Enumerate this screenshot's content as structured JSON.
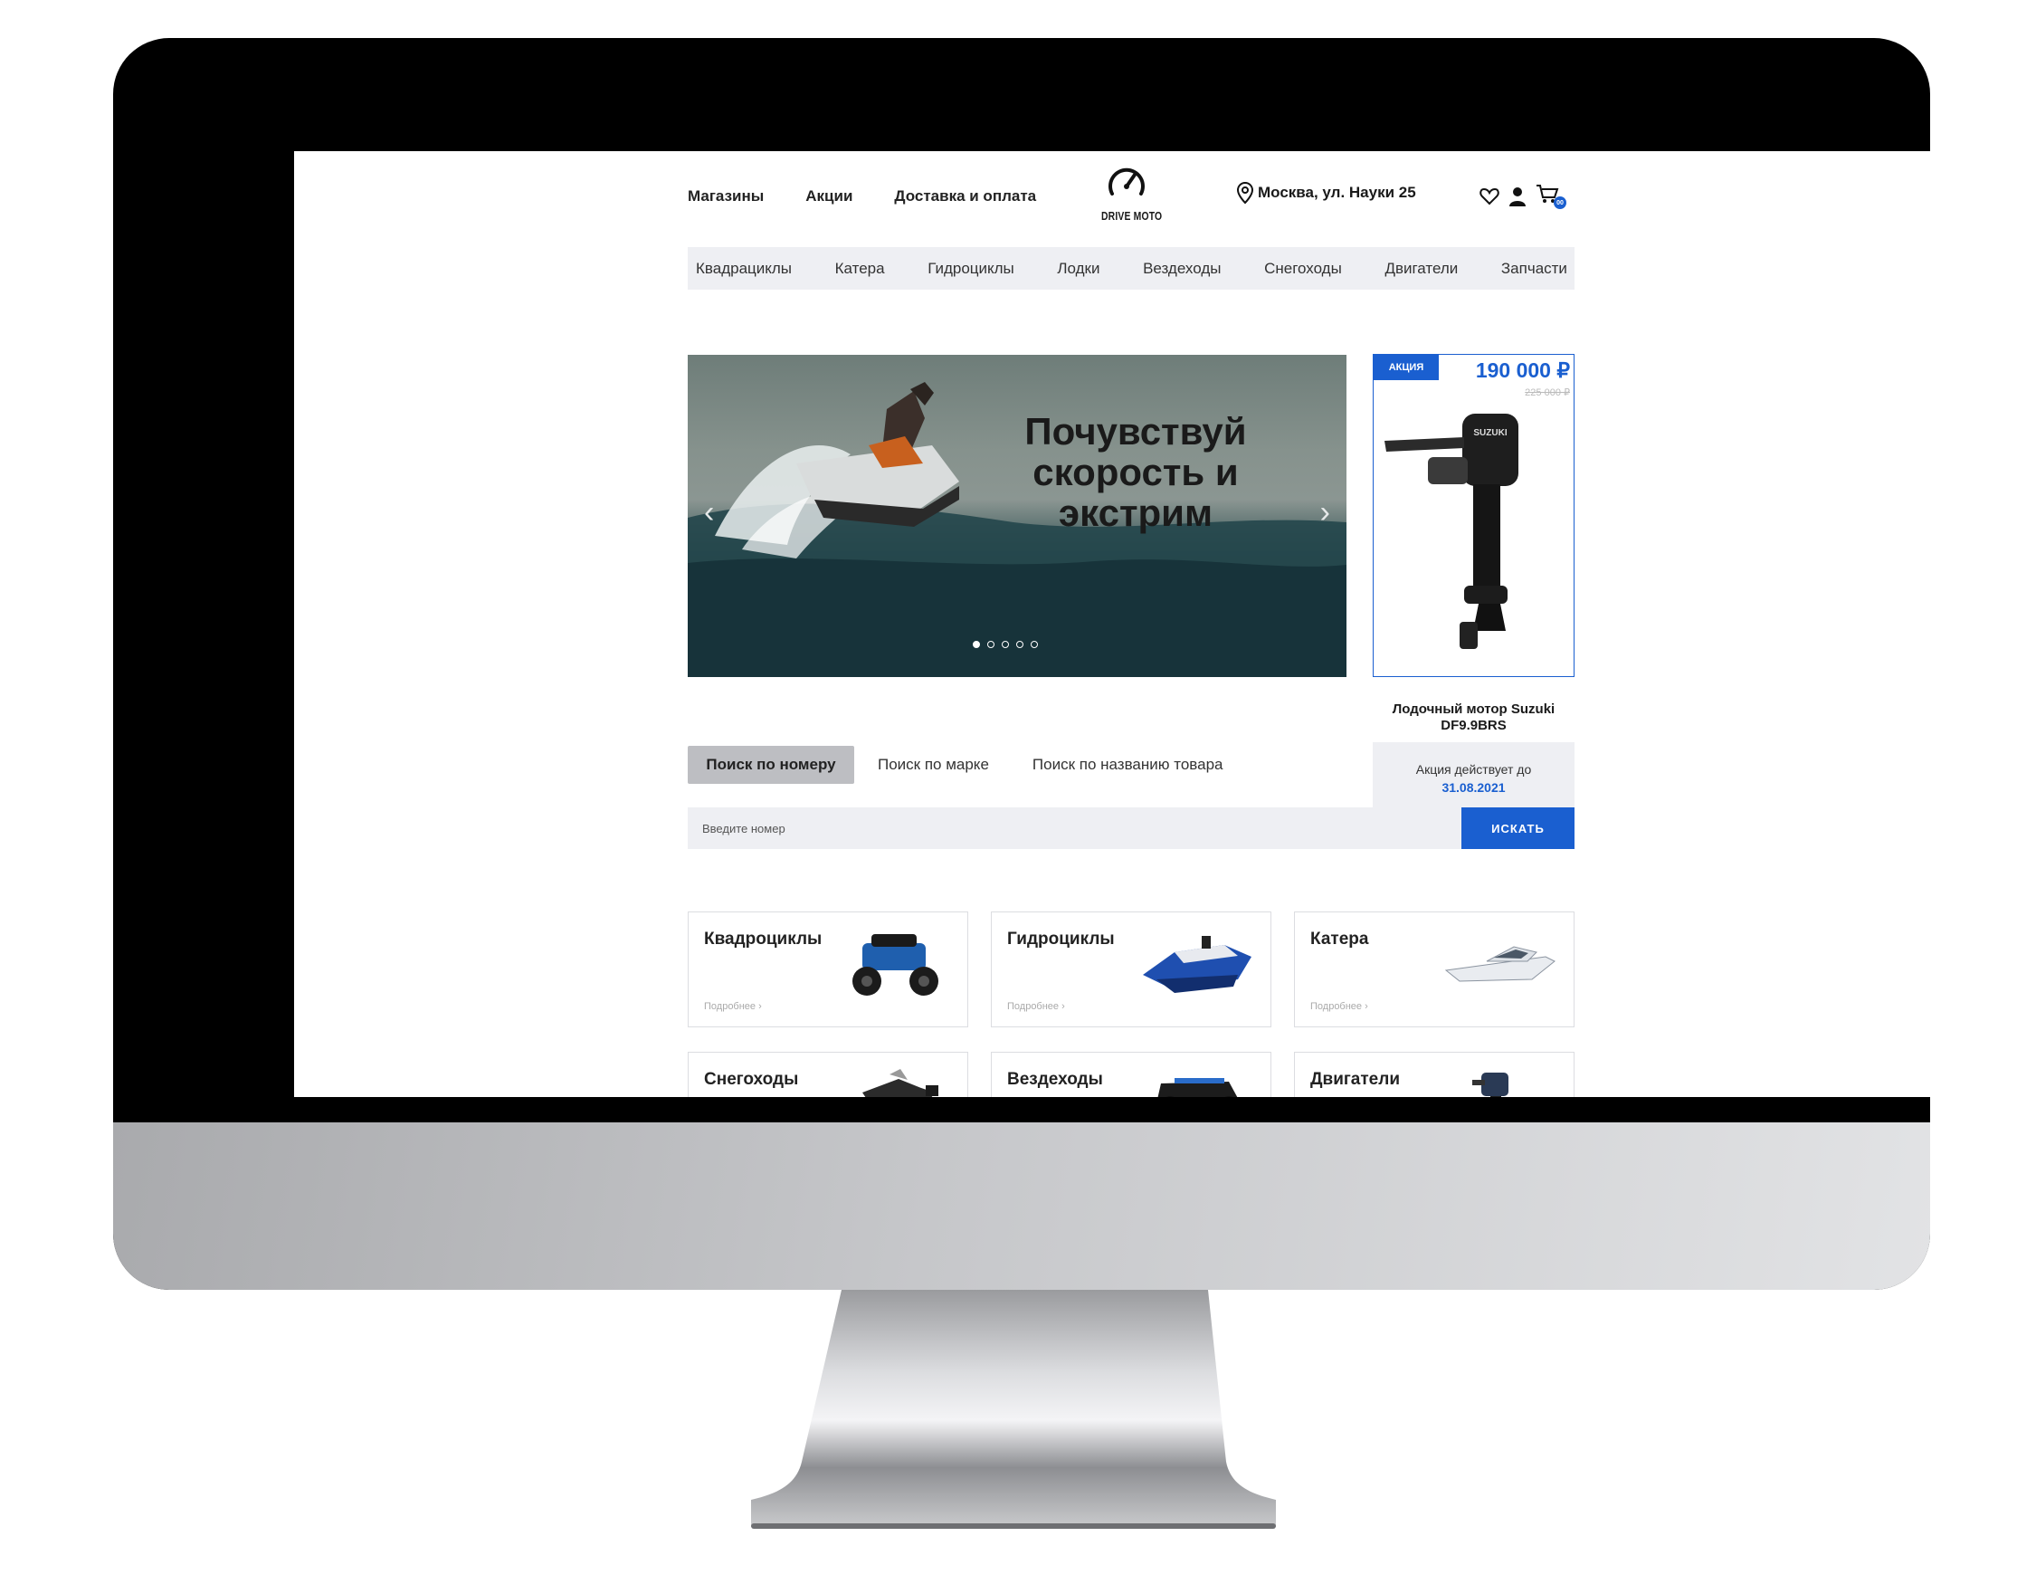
{
  "header": {
    "nav": [
      "Магазины",
      "Акции",
      "Доставка и оплата"
    ],
    "logo_text": "DRIVE MOTO",
    "address": "Москва, ул. Науки 25",
    "cart_count": "00"
  },
  "categories_bar": [
    "Квадрациклы",
    "Катера",
    "Гидроциклы",
    "Лодки",
    "Вездеходы",
    "Снегоходы",
    "Двигатели",
    "Запчасти"
  ],
  "slider": {
    "title": "Почувствуй скорость и экстрим",
    "prev": "‹",
    "next": "›",
    "slides_total": 5,
    "active_slide": 1
  },
  "promo": {
    "badge": "АКЦИЯ",
    "price": "190 000 ₽",
    "old_price": "225 000 ₽",
    "product_name": "Лодочный мотор Suzuki DF9.9BRS",
    "until_label": "Акция действует до",
    "until_date": "31.08.2021",
    "motor_brand": "SUZUKI"
  },
  "search": {
    "tabs": [
      "Поиск по номеру",
      "Поиск по марке",
      "Поиск по названию товара"
    ],
    "placeholder": "Введите номер",
    "button": "ИСКАТЬ"
  },
  "category_cards": [
    {
      "title": "Квадроциклы",
      "more": "Подробнее ›",
      "icon": "atv-image"
    },
    {
      "title": "Гидроциклы",
      "more": "Подробнее ›",
      "icon": "jetski-image"
    },
    {
      "title": "Катера",
      "more": "Подробнее ›",
      "icon": "boat-image"
    },
    {
      "title": "Снегоходы",
      "icon": "snowmobile-image"
    },
    {
      "title": "Вездеходы",
      "icon": "utv-image"
    },
    {
      "title": "Двигатели",
      "icon": "engine-image"
    }
  ],
  "colors": {
    "accent": "#1a5fd0",
    "bar_bg": "#eeeff3"
  }
}
